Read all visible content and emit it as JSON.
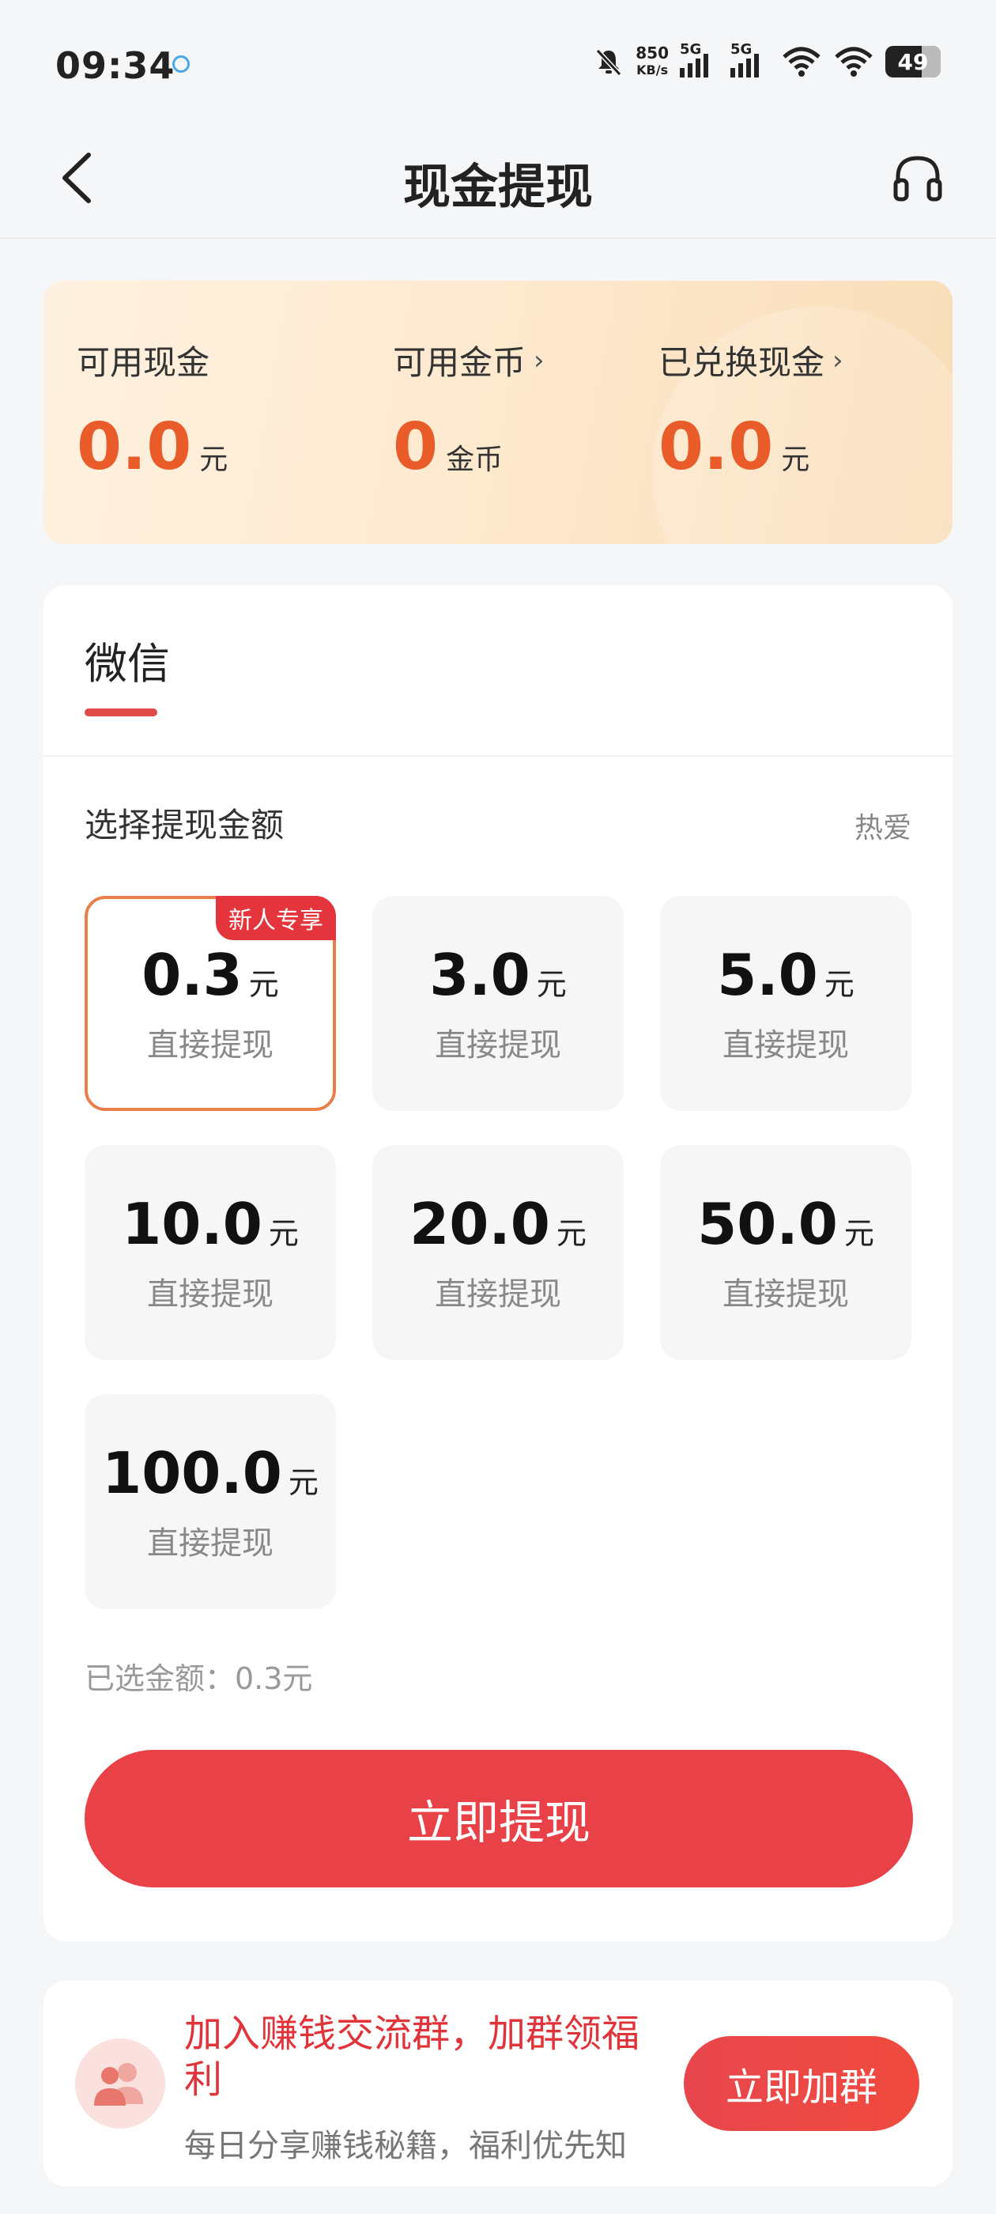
{
  "status_bar": {
    "time": "09:34",
    "net_speed_value": "850",
    "net_speed_unit": "KB/s",
    "signal1_label": "5G",
    "signal2_label": "5G",
    "battery": "49"
  },
  "nav": {
    "title": "现金提现"
  },
  "balance": {
    "cash_label": "可用现金",
    "cash_value": "0.0",
    "cash_unit": "元",
    "coins_label": "可用金币",
    "coins_value": "0",
    "coins_unit": "金币",
    "exchanged_label": "已兑换现金",
    "exchanged_value": "0.0",
    "exchanged_unit": "元",
    "chevron": "›"
  },
  "withdraw": {
    "tab_label": "微信",
    "section_title": "选择提现金额",
    "section_right": "热爱",
    "options": [
      {
        "amount": "0.3",
        "unit": "元",
        "sub": "直接提现",
        "badge": "新人专享",
        "selected": true
      },
      {
        "amount": "3.0",
        "unit": "元",
        "sub": "直接提现"
      },
      {
        "amount": "5.0",
        "unit": "元",
        "sub": "直接提现"
      },
      {
        "amount": "10.0",
        "unit": "元",
        "sub": "直接提现"
      },
      {
        "amount": "20.0",
        "unit": "元",
        "sub": "直接提现"
      },
      {
        "amount": "50.0",
        "unit": "元",
        "sub": "直接提现"
      },
      {
        "amount": "100.0",
        "unit": "元",
        "sub": "直接提现"
      }
    ],
    "selected_text": "已选金额：0.3元",
    "cta_label": "立即提现",
    "accent_color": "#e84148"
  },
  "group_banner": {
    "title": "加入赚钱交流群，加群领福利",
    "desc": "每日分享赚钱秘籍，福利优先知",
    "button_label": "立即加群"
  }
}
